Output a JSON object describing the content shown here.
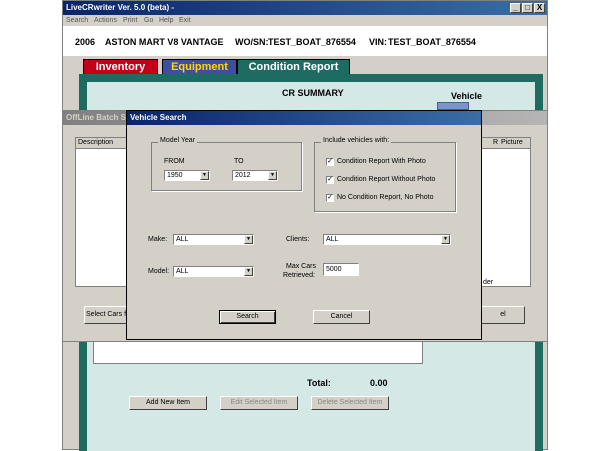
{
  "main": {
    "title": "LiveCRwriter Ver. 5.0 (beta) -",
    "window_buttons": [
      "_",
      "□",
      "X"
    ],
    "menu": [
      "Search",
      "Actions",
      "Print",
      "Go",
      "Help",
      "Exit"
    ],
    "vehicle": {
      "year": "2006",
      "name": "ASTON MART V8 VANTAGE",
      "wo_label": "WO/SN:",
      "wo_value": "TEST_BOAT_876554",
      "vin_label": "VIN:",
      "vin_value": "TEST_BOAT_876554"
    },
    "tabs": [
      "Inventory",
      "Equipment",
      "Condition Report"
    ],
    "cr_summary": "CR SUMMARY",
    "vehicle_section": "Vehicle",
    "total_label": "Total:",
    "total_value": "0.00",
    "buttons": {
      "add_item": "Add New Item",
      "edit_item": "Edit Selected Item",
      "delete_item": "Delete Selected Item"
    }
  },
  "offline": {
    "title": "OffLine Batch Setu",
    "col_description": "Description",
    "col_r": "R",
    "col_picture": "Picture",
    "select_cars": "Select Cars f",
    "right_label": "der",
    "right_button": "el"
  },
  "search": {
    "title": "Vehicle Search",
    "model_year_label": "Model Year",
    "from_label": "FROM",
    "to_label": "TO",
    "from_value": "1950",
    "to_value": "2012",
    "include_label": "Include vehicles with:",
    "options": [
      {
        "label": "Condition Report With Photo",
        "checked": true
      },
      {
        "label": "Condition Report Without Photo",
        "checked": true
      },
      {
        "label": "No Condition Report, No Photo",
        "checked": true
      }
    ],
    "make_label": "Make:",
    "make_value": "ALL",
    "model_label": "Model:",
    "model_value": "ALL",
    "clients_label": "Clients:",
    "clients_value": "ALL",
    "max_cars_label_1": "Max Cars",
    "max_cars_label_2": "Retrieved:",
    "max_cars_value": "5000",
    "search_button": "Search",
    "cancel_button": "Cancel",
    "check_mark": "✓",
    "arrow_glyph": "▼"
  }
}
